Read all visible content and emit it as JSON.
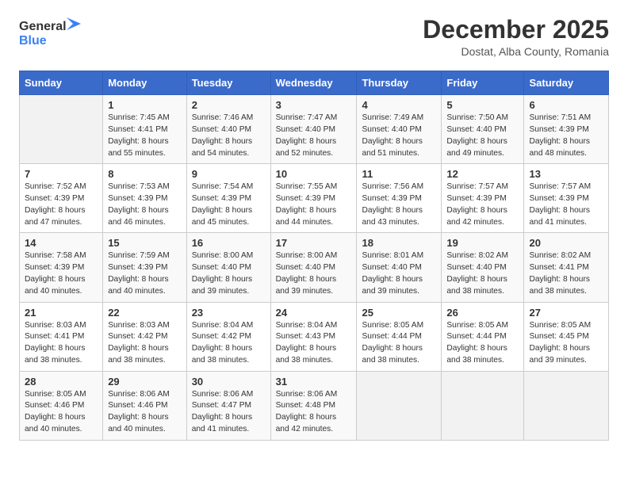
{
  "header": {
    "logo_general": "General",
    "logo_blue": "Blue",
    "month": "December 2025",
    "location": "Dostat, Alba County, Romania"
  },
  "days_of_week": [
    "Sunday",
    "Monday",
    "Tuesday",
    "Wednesday",
    "Thursday",
    "Friday",
    "Saturday"
  ],
  "weeks": [
    [
      {
        "day": "",
        "info": ""
      },
      {
        "day": "1",
        "info": "Sunrise: 7:45 AM\nSunset: 4:41 PM\nDaylight: 8 hours\nand 55 minutes."
      },
      {
        "day": "2",
        "info": "Sunrise: 7:46 AM\nSunset: 4:40 PM\nDaylight: 8 hours\nand 54 minutes."
      },
      {
        "day": "3",
        "info": "Sunrise: 7:47 AM\nSunset: 4:40 PM\nDaylight: 8 hours\nand 52 minutes."
      },
      {
        "day": "4",
        "info": "Sunrise: 7:49 AM\nSunset: 4:40 PM\nDaylight: 8 hours\nand 51 minutes."
      },
      {
        "day": "5",
        "info": "Sunrise: 7:50 AM\nSunset: 4:40 PM\nDaylight: 8 hours\nand 49 minutes."
      },
      {
        "day": "6",
        "info": "Sunrise: 7:51 AM\nSunset: 4:39 PM\nDaylight: 8 hours\nand 48 minutes."
      }
    ],
    [
      {
        "day": "7",
        "info": "Sunrise: 7:52 AM\nSunset: 4:39 PM\nDaylight: 8 hours\nand 47 minutes."
      },
      {
        "day": "8",
        "info": "Sunrise: 7:53 AM\nSunset: 4:39 PM\nDaylight: 8 hours\nand 46 minutes."
      },
      {
        "day": "9",
        "info": "Sunrise: 7:54 AM\nSunset: 4:39 PM\nDaylight: 8 hours\nand 45 minutes."
      },
      {
        "day": "10",
        "info": "Sunrise: 7:55 AM\nSunset: 4:39 PM\nDaylight: 8 hours\nand 44 minutes."
      },
      {
        "day": "11",
        "info": "Sunrise: 7:56 AM\nSunset: 4:39 PM\nDaylight: 8 hours\nand 43 minutes."
      },
      {
        "day": "12",
        "info": "Sunrise: 7:57 AM\nSunset: 4:39 PM\nDaylight: 8 hours\nand 42 minutes."
      },
      {
        "day": "13",
        "info": "Sunrise: 7:57 AM\nSunset: 4:39 PM\nDaylight: 8 hours\nand 41 minutes."
      }
    ],
    [
      {
        "day": "14",
        "info": "Sunrise: 7:58 AM\nSunset: 4:39 PM\nDaylight: 8 hours\nand 40 minutes."
      },
      {
        "day": "15",
        "info": "Sunrise: 7:59 AM\nSunset: 4:39 PM\nDaylight: 8 hours\nand 40 minutes."
      },
      {
        "day": "16",
        "info": "Sunrise: 8:00 AM\nSunset: 4:40 PM\nDaylight: 8 hours\nand 39 minutes."
      },
      {
        "day": "17",
        "info": "Sunrise: 8:00 AM\nSunset: 4:40 PM\nDaylight: 8 hours\nand 39 minutes."
      },
      {
        "day": "18",
        "info": "Sunrise: 8:01 AM\nSunset: 4:40 PM\nDaylight: 8 hours\nand 39 minutes."
      },
      {
        "day": "19",
        "info": "Sunrise: 8:02 AM\nSunset: 4:40 PM\nDaylight: 8 hours\nand 38 minutes."
      },
      {
        "day": "20",
        "info": "Sunrise: 8:02 AM\nSunset: 4:41 PM\nDaylight: 8 hours\nand 38 minutes."
      }
    ],
    [
      {
        "day": "21",
        "info": "Sunrise: 8:03 AM\nSunset: 4:41 PM\nDaylight: 8 hours\nand 38 minutes."
      },
      {
        "day": "22",
        "info": "Sunrise: 8:03 AM\nSunset: 4:42 PM\nDaylight: 8 hours\nand 38 minutes."
      },
      {
        "day": "23",
        "info": "Sunrise: 8:04 AM\nSunset: 4:42 PM\nDaylight: 8 hours\nand 38 minutes."
      },
      {
        "day": "24",
        "info": "Sunrise: 8:04 AM\nSunset: 4:43 PM\nDaylight: 8 hours\nand 38 minutes."
      },
      {
        "day": "25",
        "info": "Sunrise: 8:05 AM\nSunset: 4:44 PM\nDaylight: 8 hours\nand 38 minutes."
      },
      {
        "day": "26",
        "info": "Sunrise: 8:05 AM\nSunset: 4:44 PM\nDaylight: 8 hours\nand 38 minutes."
      },
      {
        "day": "27",
        "info": "Sunrise: 8:05 AM\nSunset: 4:45 PM\nDaylight: 8 hours\nand 39 minutes."
      }
    ],
    [
      {
        "day": "28",
        "info": "Sunrise: 8:05 AM\nSunset: 4:46 PM\nDaylight: 8 hours\nand 40 minutes."
      },
      {
        "day": "29",
        "info": "Sunrise: 8:06 AM\nSunset: 4:46 PM\nDaylight: 8 hours\nand 40 minutes."
      },
      {
        "day": "30",
        "info": "Sunrise: 8:06 AM\nSunset: 4:47 PM\nDaylight: 8 hours\nand 41 minutes."
      },
      {
        "day": "31",
        "info": "Sunrise: 8:06 AM\nSunset: 4:48 PM\nDaylight: 8 hours\nand 42 minutes."
      },
      {
        "day": "",
        "info": ""
      },
      {
        "day": "",
        "info": ""
      },
      {
        "day": "",
        "info": ""
      }
    ]
  ]
}
